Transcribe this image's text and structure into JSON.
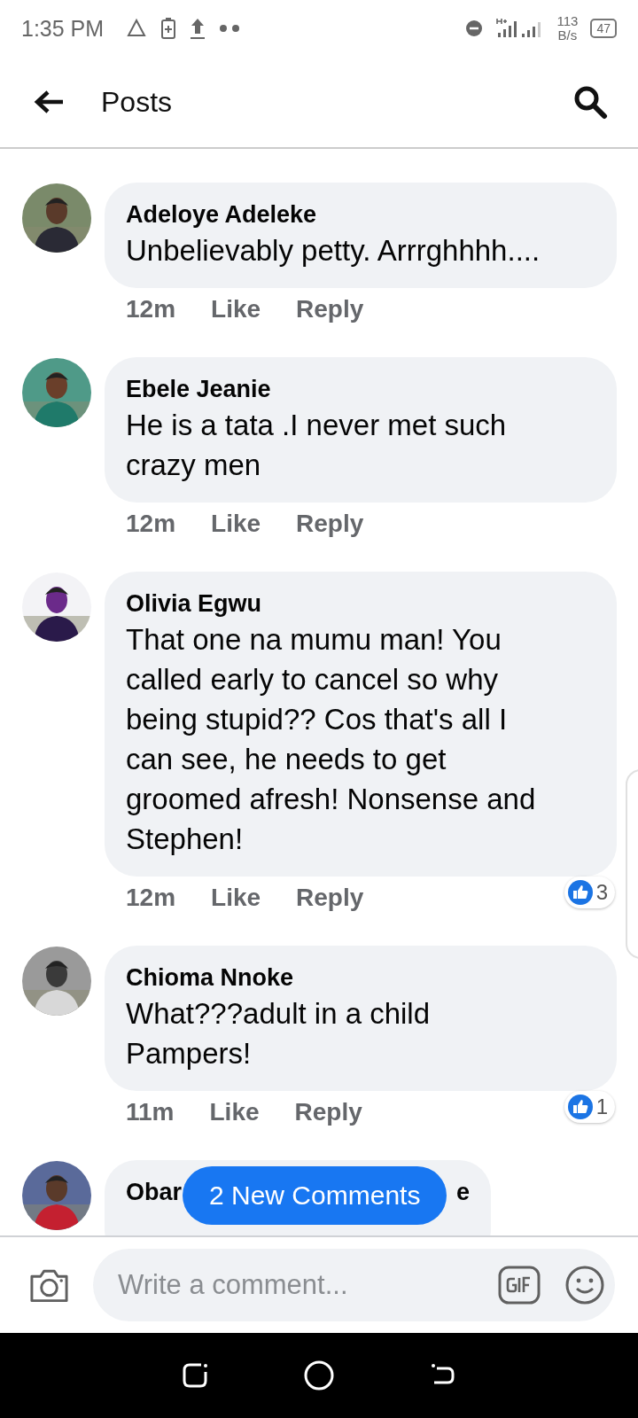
{
  "status_bar": {
    "time": "1:35 PM",
    "network_speed": "113",
    "network_unit": "B/s",
    "battery": "47"
  },
  "header": {
    "title": "Posts"
  },
  "comments": [
    {
      "name": "Adeloye Adeleke",
      "text": "Unbelievably petty. Arrrghhhh....",
      "time": "12m",
      "like": "Like",
      "reply": "Reply"
    },
    {
      "name": "Ebele Jeanie",
      "text": "He is a tata .I never met such crazy men",
      "time": "12m",
      "like": "Like",
      "reply": "Reply"
    },
    {
      "name": "Olivia Egwu",
      "text": "That one na mumu man! You called early to cancel so why being stupid?? Cos that's all I can see, he needs to get groomed afresh! Nonsense and Stephen!",
      "time": "12m",
      "like": "Like",
      "reply": "Reply",
      "reactions": "3"
    },
    {
      "name": "Chioma Nnoke",
      "text": "What???adult in a child Pampers!",
      "time": "11m",
      "like": "Like",
      "reply": "Reply",
      "reactions": "1"
    },
    {
      "name": "Obar",
      "name_end": "e"
    }
  ],
  "new_comments_button": "2 New Comments",
  "composer": {
    "placeholder": "Write a comment..."
  }
}
